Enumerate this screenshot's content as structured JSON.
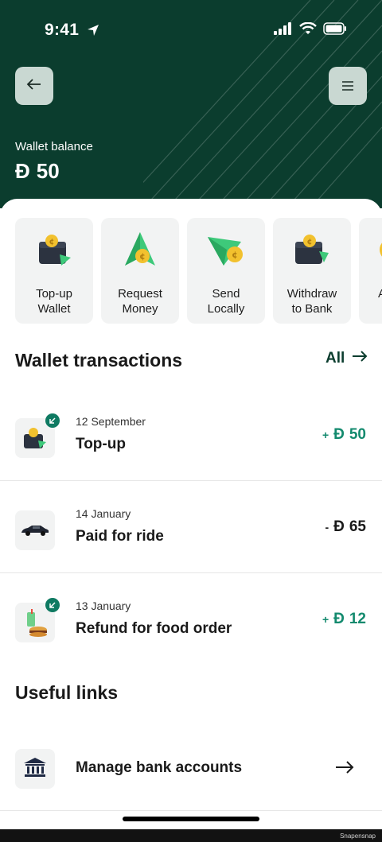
{
  "status_bar": {
    "time": "9:41"
  },
  "header": {
    "balance_label": "Wallet balance",
    "balance_currency": "Đ",
    "balance_amount": "50"
  },
  "actions": [
    {
      "label_line1": "Top-up",
      "label_line2": "Wallet",
      "icon": "wallet-topup-icon"
    },
    {
      "label_line1": "Request",
      "label_line2": "Money",
      "icon": "request-money-icon"
    },
    {
      "label_line1": "Send",
      "label_line2": "Locally",
      "icon": "send-money-icon"
    },
    {
      "label_line1": "Withdraw",
      "label_line2": "to Bank",
      "icon": "withdraw-icon"
    },
    {
      "label_line1": "",
      "label_line2": "A",
      "icon": "partial-action-icon"
    }
  ],
  "transactions_section": {
    "title": "Wallet transactions",
    "all_label": "All"
  },
  "transactions": [
    {
      "date": "12 September",
      "title": "Top-up",
      "sign": "+",
      "currency": "Đ",
      "amount": "50",
      "icon": "wallet-topup-icon",
      "badge": true
    },
    {
      "date": "14 January",
      "title": "Paid for ride",
      "sign": "-",
      "currency": "Đ",
      "amount": "65",
      "icon": "car-icon",
      "badge": false
    },
    {
      "date": "13 January",
      "title": "Refund for food order",
      "sign": "+",
      "currency": "Đ",
      "amount": "12",
      "icon": "food-icon",
      "badge": true
    }
  ],
  "useful_links": {
    "title": "Useful links",
    "items": [
      {
        "label": "Manage bank accounts",
        "icon": "bank-icon"
      }
    ]
  },
  "footer": {
    "watermark": "Snapensnap"
  },
  "colors": {
    "header_bg": "#0b3d2e",
    "positive": "#138a6e",
    "badge": "#0f7a62"
  }
}
